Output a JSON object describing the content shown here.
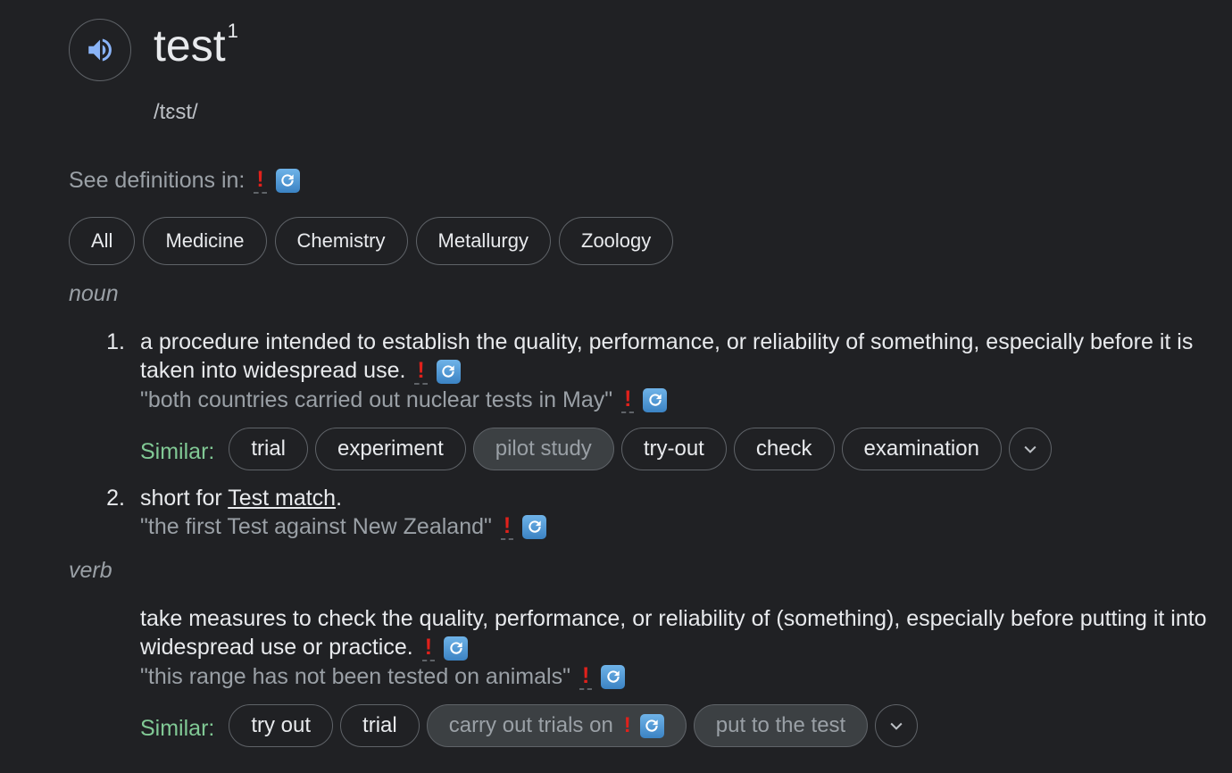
{
  "entry": {
    "word": "test",
    "superscript": "1",
    "phonetic": "/tɛst/"
  },
  "see_definitions": {
    "label": "See definitions in:",
    "excl": "!"
  },
  "domains": [
    "All",
    "Medicine",
    "Chemistry",
    "Metallurgy",
    "Zoology"
  ],
  "noun": {
    "label": "noun",
    "senses": [
      {
        "number": "1.",
        "definition": "a procedure intended to establish the quality, performance, or reliability of something, especially before it is taken into widespread use.",
        "example": "\"both countries carried out nuclear tests in May\"",
        "similar_label": "Similar:",
        "similar": [
          "trial",
          "experiment",
          "pilot study",
          "try-out",
          "check",
          "examination"
        ]
      },
      {
        "number": "2.",
        "definition_prefix": "short for ",
        "definition_link": "Test match",
        "definition_suffix": ".",
        "example": "\"the first Test against New Zealand\""
      }
    ]
  },
  "verb": {
    "label": "verb",
    "definition": "take measures to check the quality, performance, or reliability of (something), especially before putting it into widespread use or practice.",
    "example": "\"this range has not been tested on animals\"",
    "similar_label": "Similar:",
    "similar": [
      "try out",
      "trial",
      "carry out trials on",
      "put to the test"
    ]
  },
  "icons": {
    "speaker": "speaker-icon",
    "refresh": "refresh-icon",
    "chevron": "chevron-down-icon"
  },
  "colors": {
    "background": "#202124",
    "similar_label": "#81c995",
    "exclamation": "#e0211b",
    "refresh_icon": "#4a90d9"
  }
}
